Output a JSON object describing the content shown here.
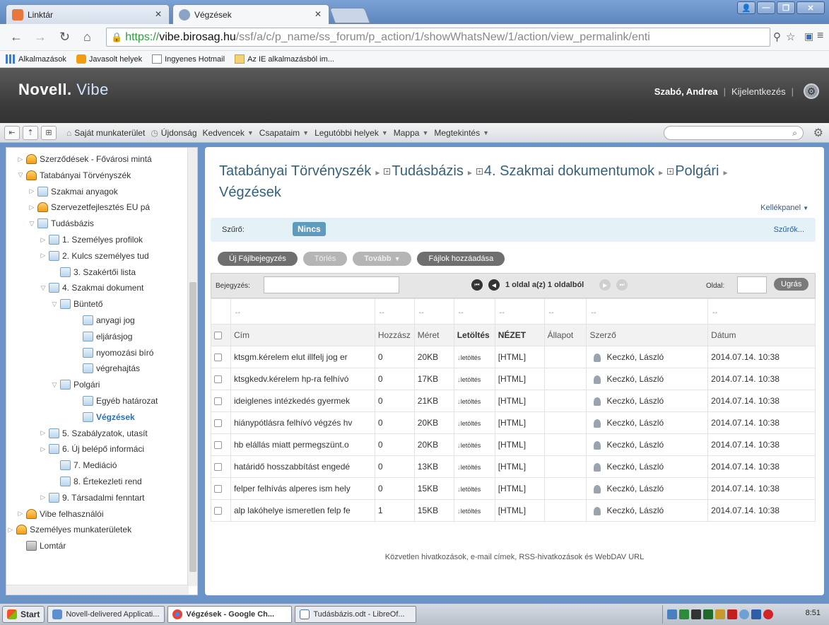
{
  "browser": {
    "tabs": [
      {
        "title": "Linktár",
        "active": false
      },
      {
        "title": "Végzések",
        "active": true
      }
    ],
    "url": {
      "scheme": "https://",
      "host": "vibe.birosag.hu",
      "path": "/ssf/a/c/p_name/ss_forum/p_action/1/showWhatsNew/1/action/view_permalink/enti"
    },
    "bookmarks": [
      {
        "label": "Alkalmazások",
        "icon": "apps-grid-icon"
      },
      {
        "label": "Javasolt helyek",
        "icon": "suggested-sites-icon"
      },
      {
        "label": "Ingyenes Hotmail",
        "icon": "page-icon"
      },
      {
        "label": "Az IE alkalmazásból im...",
        "icon": "folder-icon"
      }
    ]
  },
  "vibe": {
    "logo_brand": "Novell.",
    "logo_product": "Vibe",
    "user_name": "Szabó, Andrea",
    "logout_label": "Kijelentkezés",
    "toolbar": {
      "my_workspace": "Saját munkaterület",
      "whats_new": "Újdonság",
      "favorites": "Kedvencek",
      "teams": "Csapataim",
      "recent": "Legutóbbi helyek",
      "folder": "Mappa",
      "view": "Megtekintés"
    }
  },
  "tree": [
    {
      "label": "Szerződések - Fővárosi mintá",
      "icon": "team",
      "twisty": "▷"
    },
    {
      "label": "Tatabányai Törvényszék",
      "icon": "team",
      "twisty": "▽"
    },
    {
      "label": "Szakmai anyagok",
      "icon": "doc",
      "twisty": "▷"
    },
    {
      "label": "Szervezetfejlesztés EU pá",
      "icon": "team",
      "twisty": "▷"
    },
    {
      "label": "Tudásbázis",
      "icon": "doc",
      "twisty": "▽"
    },
    {
      "label": "1. Személyes profilok",
      "icon": "doc",
      "twisty": "▷"
    },
    {
      "label": "2. Kulcs személyes tud",
      "icon": "doc",
      "twisty": "▷"
    },
    {
      "label": "3. Szakértői lista",
      "icon": "doc",
      "twisty": ""
    },
    {
      "label": "4. Szakmai dokument",
      "icon": "doc",
      "twisty": "▽"
    },
    {
      "label": "Büntető",
      "icon": "doc",
      "twisty": "▽"
    },
    {
      "label": "anyagi jog",
      "icon": "doc",
      "twisty": ""
    },
    {
      "label": "eljárásjog",
      "icon": "doc",
      "twisty": ""
    },
    {
      "label": "nyomozási bíró",
      "icon": "doc",
      "twisty": ""
    },
    {
      "label": "végrehajtás",
      "icon": "doc",
      "twisty": ""
    },
    {
      "label": "Polgári",
      "icon": "doc",
      "twisty": "▽"
    },
    {
      "label": "Egyéb határozat",
      "icon": "doc",
      "twisty": ""
    },
    {
      "label": "Végzések",
      "icon": "doc",
      "twisty": "",
      "selected": true
    },
    {
      "label": "5. Szabályzatok, utasít",
      "icon": "doc",
      "twisty": "▷"
    },
    {
      "label": "6. Új belépő informáci",
      "icon": "doc",
      "twisty": "▷"
    },
    {
      "label": "7. Mediáció",
      "icon": "doc",
      "twisty": ""
    },
    {
      "label": "8. Értekezleti rend",
      "icon": "doc",
      "twisty": ""
    },
    {
      "label": "9. Társadalmi fenntart",
      "icon": "doc",
      "twisty": "▷"
    },
    {
      "label": "Vibe felhasználói",
      "icon": "team",
      "twisty": "▷"
    },
    {
      "label": "Személyes munkaterületek",
      "icon": "team",
      "twisty": "▷"
    },
    {
      "label": "Lomtár",
      "icon": "trash",
      "twisty": ""
    }
  ],
  "main": {
    "breadcrumb": [
      "Tatabányai Törvényszék",
      "Tudásbázis",
      "4. Szakmai dokumentumok",
      "Polgári"
    ],
    "title": "Végzések",
    "toolpanel": "Kellékpanel",
    "filter_label": "Szűrő:",
    "filter_value": "Nincs",
    "filters_link": "Szűrők...",
    "actions": {
      "new_file": "Új Fájlbejegyzés",
      "delete": "Törlés",
      "more": "Tovább",
      "add_files": "Fájlok hozzáadása"
    },
    "pager": {
      "entry_label": "Bejegyzés:",
      "summary": "1 oldal a(z) 1 oldalból",
      "page_label": "Oldal:",
      "go_label": "Ugrás"
    },
    "columns": [
      "Cím",
      "Hozzász",
      "Méret",
      "Letöltés",
      "NÉZET",
      "Állapot",
      "Szerző",
      "Dátum"
    ],
    "resize_glyph": "↔",
    "rows": [
      {
        "title": "ktsgm.kérelem elut illfelj jog er",
        "comments": "0",
        "size": "20KB",
        "download": "letöltés",
        "view": "[HTML]",
        "status": "",
        "author": "Keczkó, László",
        "date": "2014.07.14. 10:38"
      },
      {
        "title": "ktsgkedv.kérelem hp-ra felhívó",
        "comments": "0",
        "size": "17KB",
        "download": "letöltés",
        "view": "[HTML]",
        "status": "",
        "author": "Keczkó, László",
        "date": "2014.07.14. 10:38"
      },
      {
        "title": "ideiglenes intézkedés gyermek",
        "comments": "0",
        "size": "21KB",
        "download": "letöltés",
        "view": "[HTML]",
        "status": "",
        "author": "Keczkó, László",
        "date": "2014.07.14. 10:38"
      },
      {
        "title": "hiánypótlásra felhívó végzés hv",
        "comments": "0",
        "size": "20KB",
        "download": "letöltés",
        "view": "[HTML]",
        "status": "",
        "author": "Keczkó, László",
        "date": "2014.07.14. 10:38"
      },
      {
        "title": "hb elállás miatt permegszünt.o",
        "comments": "0",
        "size": "20KB",
        "download": "letöltés",
        "view": "[HTML]",
        "status": "",
        "author": "Keczkó, László",
        "date": "2014.07.14. 10:38"
      },
      {
        "title": "határidő hosszabbítást engedé",
        "comments": "0",
        "size": "13KB",
        "download": "letöltés",
        "view": "[HTML]",
        "status": "",
        "author": "Keczkó, László",
        "date": "2014.07.14. 10:38"
      },
      {
        "title": "felper felhívás alperes ism hely",
        "comments": "0",
        "size": "15KB",
        "download": "letöltés",
        "view": "[HTML]",
        "status": "",
        "author": "Keczkó, László",
        "date": "2014.07.14. 10:38"
      },
      {
        "title": "alp lakóhelye ismeretlen felp fe",
        "comments": "1",
        "size": "15KB",
        "download": "letöltés",
        "view": "[HTML]",
        "status": "",
        "author": "Keczkó, László",
        "date": "2014.07.14. 10:38"
      }
    ],
    "footer": "Közvetlen hivatkozások, e-mail címek, RSS-hivatkozások és WebDAV URL"
  },
  "taskbar": {
    "start": "Start",
    "tasks": [
      {
        "label": "Novell-delivered Applicati...",
        "active": false
      },
      {
        "label": "Végzések - Google Ch...",
        "active": true
      },
      {
        "label": "Tudásbázis.odt - LibreOf...",
        "active": false
      }
    ],
    "clock": "8:51"
  },
  "colors": {
    "accent": "#35627a",
    "link": "#2c5f92",
    "filter_badge": "#5e9bbd",
    "selected_tree": "#2c6fb5"
  }
}
